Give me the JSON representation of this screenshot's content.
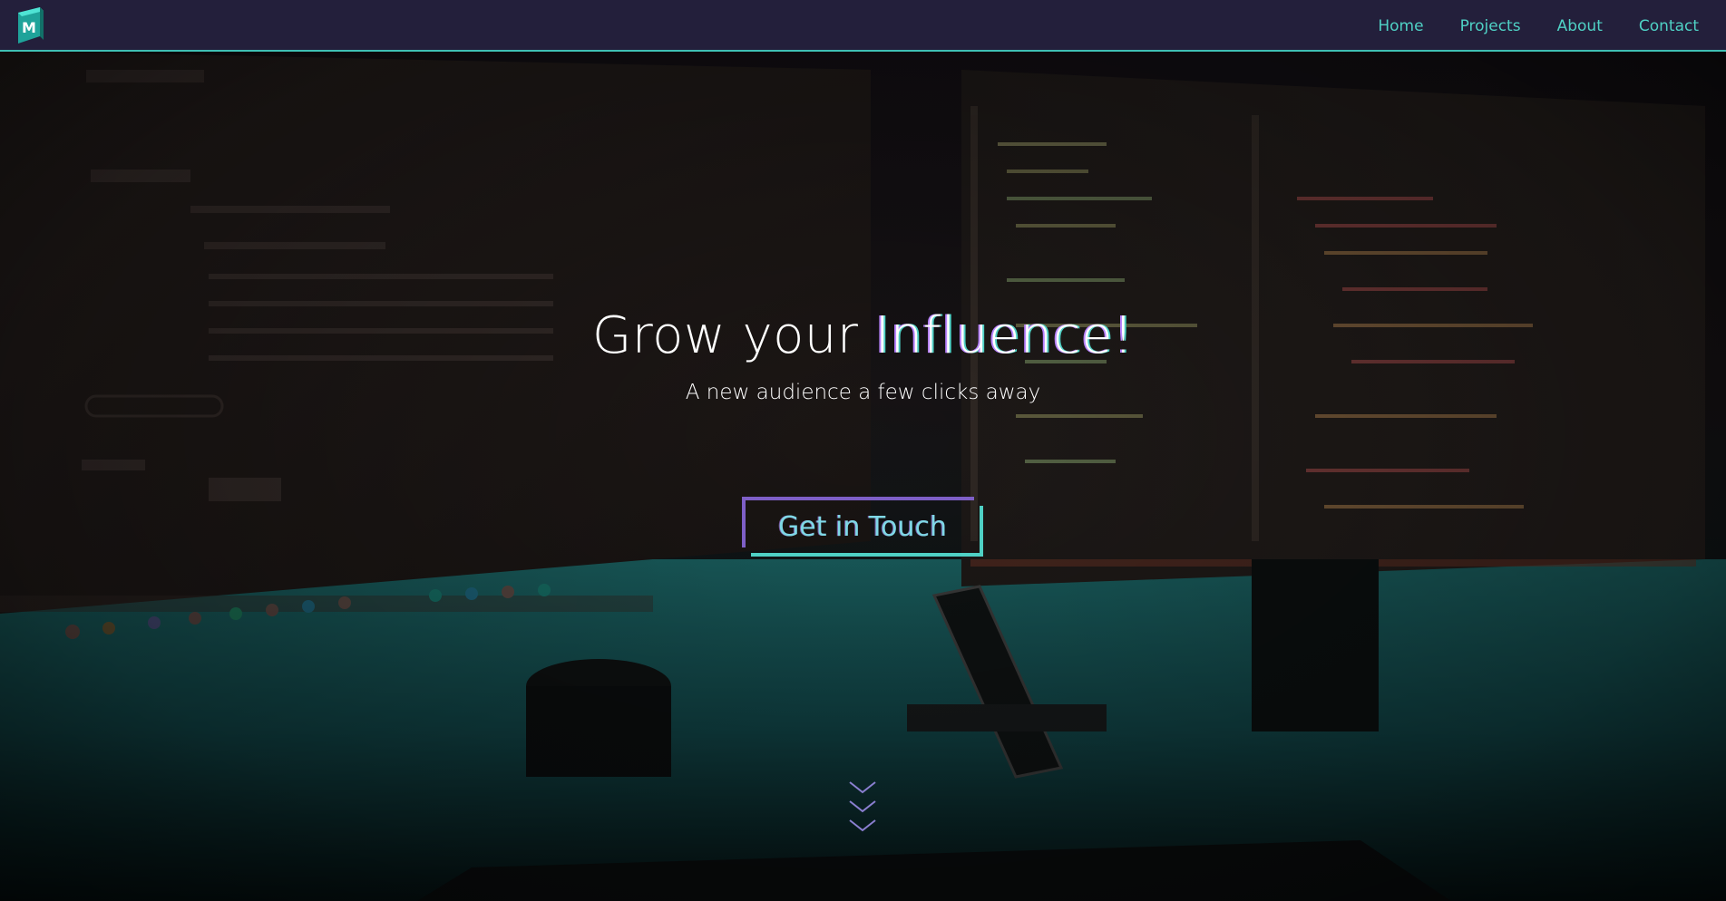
{
  "nav": {
    "logo_letter": "M",
    "links": [
      {
        "label": "Home"
      },
      {
        "label": "Projects"
      },
      {
        "label": "About"
      },
      {
        "label": "Contact"
      }
    ]
  },
  "hero": {
    "headline_start": "Grow your ",
    "headline_accent": "Influence!",
    "subtitle": "A new audience a few clicks away",
    "cta_label": "Get in Touch",
    "background_description_icon": "desk-monitors-photo"
  },
  "colors": {
    "nav_bg": "#231f3b",
    "accent_teal": "#4fd1c5",
    "accent_purple": "#7e5fc7",
    "text_white": "#ffffff"
  }
}
